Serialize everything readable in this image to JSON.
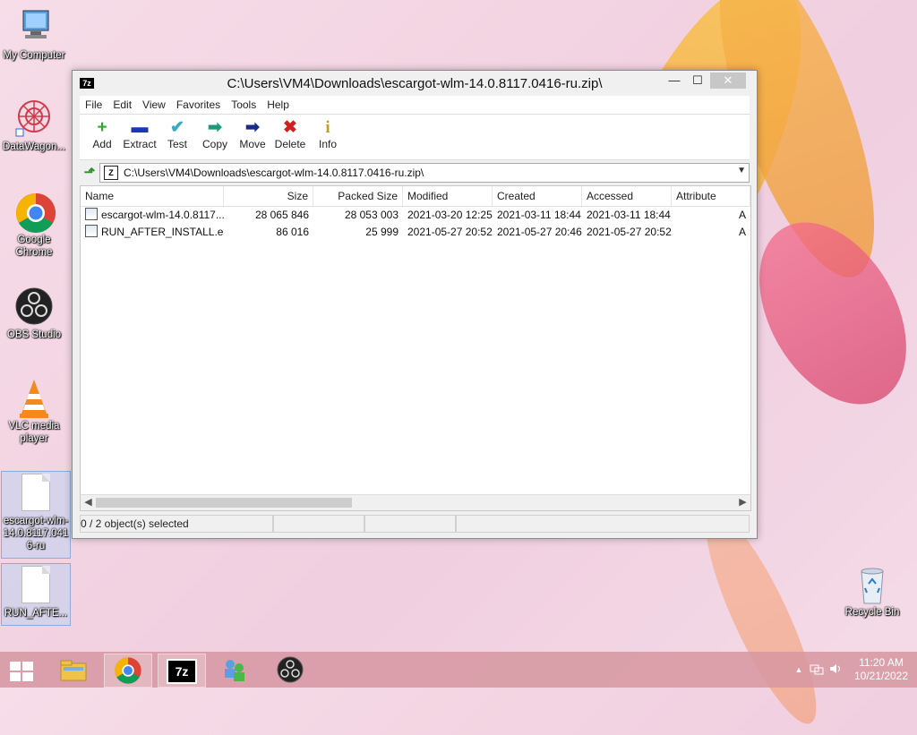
{
  "desktop": {
    "icons": [
      {
        "label": "My Computer"
      },
      {
        "label": "DataWagon..."
      },
      {
        "label": "Google Chrome"
      },
      {
        "label": "OBS Studio"
      },
      {
        "label": "VLC media player"
      },
      {
        "label": "escargot-wlm-14.0.8117.0416-ru"
      },
      {
        "label": "RUN_AFTE..."
      },
      {
        "label": "Recycle Bin"
      }
    ]
  },
  "window": {
    "title": "C:\\Users\\VM4\\Downloads\\escargot-wlm-14.0.8117.0416-ru.zip\\",
    "app_logo": "7z",
    "controls": {
      "minimize": "—",
      "maximize": "☐",
      "close": "✕"
    },
    "menu": [
      "File",
      "Edit",
      "View",
      "Favorites",
      "Tools",
      "Help"
    ],
    "toolbar": [
      {
        "label": "Add",
        "icon": "+",
        "color": "#2fa82f"
      },
      {
        "label": "Extract",
        "icon": "▬",
        "color": "#1c36b8"
      },
      {
        "label": "Test",
        "icon": "✔",
        "color": "#3aa9c7"
      },
      {
        "label": "Copy",
        "icon": "➡",
        "color": "#1a9a7a"
      },
      {
        "label": "Move",
        "icon": "➡",
        "color": "#1a2a8a"
      },
      {
        "label": "Delete",
        "icon": "✖",
        "color": "#d01f1f"
      },
      {
        "label": "Info",
        "icon": "i",
        "color": "#c8a400"
      }
    ],
    "address": "C:\\Users\\VM4\\Downloads\\escargot-wlm-14.0.8117.0416-ru.zip\\",
    "columns": [
      "Name",
      "Size",
      "Packed Size",
      "Modified",
      "Created",
      "Accessed",
      "Attribute"
    ],
    "rows": [
      [
        "escargot-wlm-14.0.8117...",
        "28 065 846",
        "28 053 003",
        "2021-03-20 12:25",
        "2021-03-11 18:44",
        "2021-03-11 18:44",
        "A"
      ],
      [
        "RUN_AFTER_INSTALL.exe",
        "86 016",
        "25 999",
        "2021-05-27 20:52",
        "2021-05-27 20:46",
        "2021-05-27 20:52",
        "A"
      ]
    ],
    "status": "0 / 2 object(s) selected"
  },
  "taskbar": {
    "clock_time": "11:20 AM",
    "clock_date": "10/21/2022",
    "pinned_7z": "7z"
  }
}
